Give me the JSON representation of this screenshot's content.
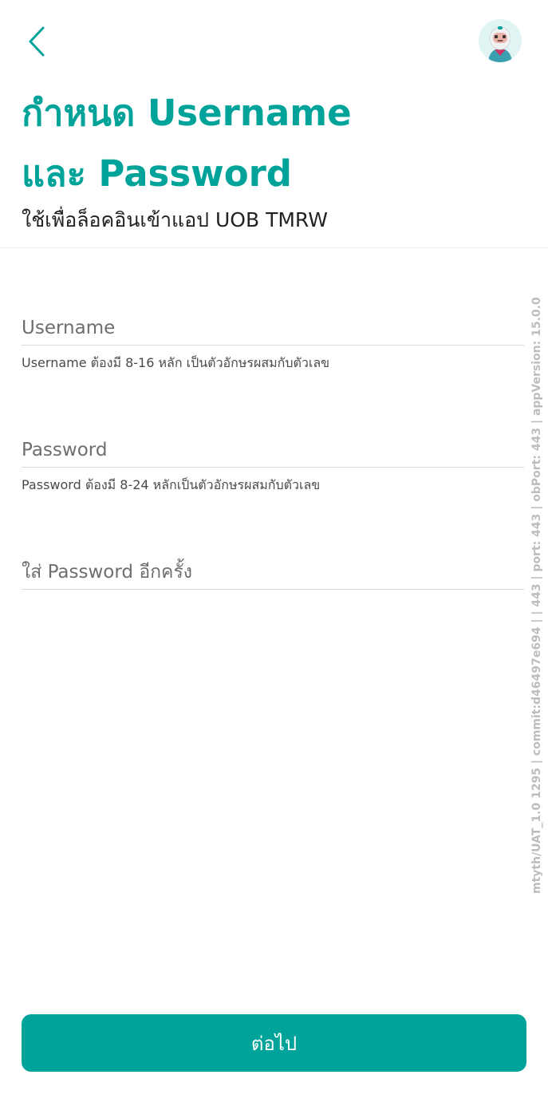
{
  "header": {
    "back_icon": "chevron-left-icon",
    "avatar_icon": "astronaut-avatar-icon",
    "title_line1": "กำหนด Username",
    "title_line2": "และ Password",
    "subtitle": "ใช้เพื่อล็อคอินเข้าแอป UOB TMRW"
  },
  "form": {
    "username": {
      "placeholder": "Username",
      "value": "",
      "hint": "Username ต้องมี 8-16 หลัก เป็นตัวอักษรผสมกับตัวเลข"
    },
    "password": {
      "placeholder": "Password",
      "value": "",
      "hint": "Password ต้องมี 8-24 หลักเป็นตัวอักษรผสมกับตัวเลข"
    },
    "confirm_password": {
      "placeholder": "ใส่ Password อีกครั้ง",
      "value": ""
    }
  },
  "footer": {
    "next_label": "ต่อไป"
  },
  "debug": {
    "version_text": "mtyth/UAT_1.0 1295 | commit:d46497e694 | | 443 | port: 443 | obPort: 443 | appVersion: 15.0.0"
  },
  "colors": {
    "accent": "#00a399",
    "text": "#222222",
    "divider": "#d9d9d9",
    "debug_text": "#bdbdbd"
  }
}
